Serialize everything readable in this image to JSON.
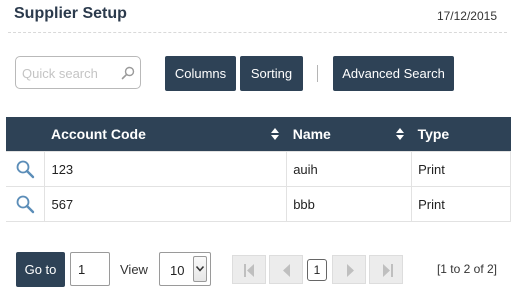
{
  "header": {
    "title": "Supplier Setup",
    "date": "17/12/2015"
  },
  "toolbar": {
    "search_placeholder": "Quick search",
    "columns_label": "Columns",
    "sorting_label": "Sorting",
    "advanced_search_label": "Advanced Search"
  },
  "table": {
    "columns": [
      "Account Code",
      "Name",
      "Type"
    ],
    "rows": [
      {
        "account_code": "123",
        "name": "auih",
        "type": "Print"
      },
      {
        "account_code": "567",
        "name": "bbb",
        "type": "Print"
      }
    ]
  },
  "footer": {
    "goto_label": "Go to",
    "page_value": "1",
    "view_label": "View",
    "view_value": "10",
    "current_page": "1",
    "summary": "[1 to 2 of 2]"
  },
  "colors": {
    "header_bg": "#2e4256",
    "search_icon": "#5b8db8"
  }
}
